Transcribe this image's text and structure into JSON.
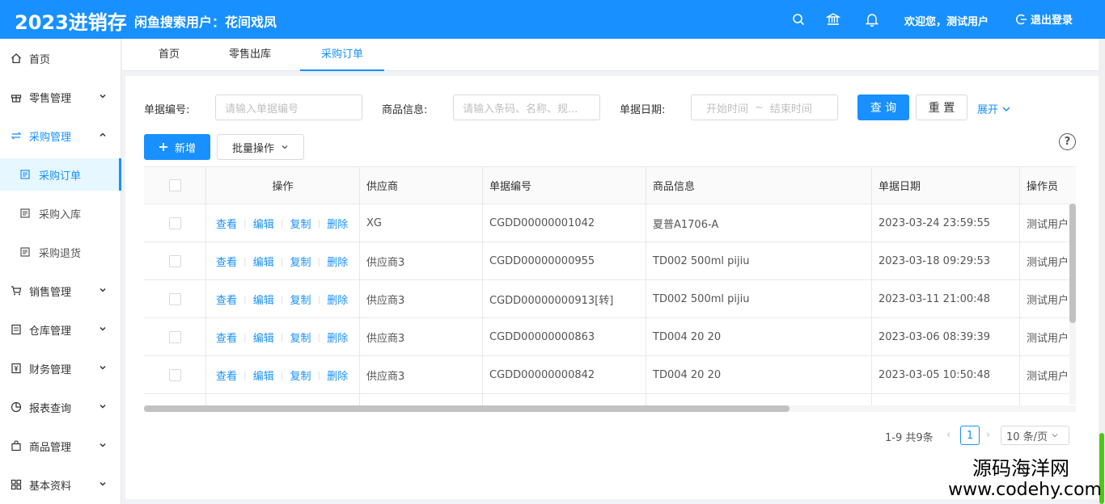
{
  "header": {
    "logo": "2023进销存",
    "user_info": "闲鱼搜索用户：花间戏凤",
    "welcome": "欢迎您，测试用户",
    "logout": "退出登录"
  },
  "sidebar": {
    "items": [
      {
        "label": "首页",
        "icon": "home-icon"
      },
      {
        "label": "零售管理",
        "icon": "gift-icon"
      },
      {
        "label": "采购管理",
        "icon": "swap-icon"
      },
      {
        "label": "销售管理",
        "icon": "cart-icon"
      },
      {
        "label": "仓库管理",
        "icon": "warehouse-icon"
      },
      {
        "label": "财务管理",
        "icon": "finance-icon"
      },
      {
        "label": "报表查询",
        "icon": "pie-chart-icon"
      },
      {
        "label": "商品管理",
        "icon": "bag-icon"
      },
      {
        "label": "基本资料",
        "icon": "grid-icon"
      }
    ],
    "sub_items": [
      {
        "label": "采购订单"
      },
      {
        "label": "采购入库"
      },
      {
        "label": "采购退货"
      }
    ]
  },
  "tabs": [
    {
      "label": "首页"
    },
    {
      "label": "零售出库"
    },
    {
      "label": "采购订单"
    }
  ],
  "search": {
    "bill_no_label": "单据编号:",
    "bill_no_placeholder": "请输入单据编号",
    "goods_label": "商品信息:",
    "goods_placeholder": "请输入条码、名称、规...",
    "date_label": "单据日期:",
    "date_start": "开始时间",
    "date_sep": "~",
    "date_end": "结束时间",
    "query": "查 询",
    "reset": "重 置",
    "expand": "展开"
  },
  "toolbar": {
    "add": "新增",
    "batch": "批量操作",
    "help": "?"
  },
  "table": {
    "columns": [
      "操作",
      "供应商",
      "单据编号",
      "商品信息",
      "单据日期",
      "操作员"
    ],
    "actions": [
      "查看",
      "编辑",
      "复制",
      "删除"
    ],
    "rows": [
      {
        "supplier": "XG",
        "bill_no": "CGDD00000001042",
        "goods": "夏普A1706-A",
        "date": "2023-03-24 23:59:55",
        "operator": "测试用户"
      },
      {
        "supplier": "供应商3",
        "bill_no": "CGDD00000000955",
        "goods": "TD002 500ml pijiu",
        "date": "2023-03-18 09:29:53",
        "operator": "测试用户"
      },
      {
        "supplier": "供应商3",
        "bill_no": "CGDD00000000913[转]",
        "goods": "TD002 500ml pijiu",
        "date": "2023-03-11 21:00:48",
        "operator": "测试用户"
      },
      {
        "supplier": "供应商3",
        "bill_no": "CGDD00000000863",
        "goods": "TD004 20 20",
        "date": "2023-03-06 08:39:39",
        "operator": "测试用户"
      },
      {
        "supplier": "供应商3",
        "bill_no": "CGDD00000000842",
        "goods": "TD004 20 20",
        "date": "2023-03-05 10:50:48",
        "operator": "测试用户"
      }
    ]
  },
  "pagination": {
    "total": "1-9 共9条",
    "current": "1",
    "page_size": "10 条/页"
  },
  "watermark": {
    "line1": "源码海洋网",
    "line2": "www.codehy.com"
  },
  "colors": {
    "primary": "#1890ff",
    "scroll_accent": "#52c41a"
  }
}
